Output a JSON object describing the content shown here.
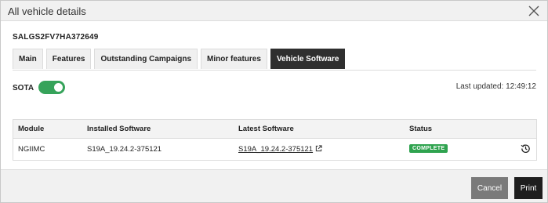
{
  "dialog": {
    "title": "All vehicle details",
    "close_icon": "close-icon"
  },
  "vin": "SALGS2FV7HA372649",
  "tabs": [
    {
      "label": "Main",
      "active": false
    },
    {
      "label": "Features",
      "active": false
    },
    {
      "label": "Outstanding Campaigns",
      "active": false
    },
    {
      "label": "Minor features",
      "active": false
    },
    {
      "label": "Vehicle Software",
      "active": true
    }
  ],
  "sota": {
    "label": "SOTA",
    "enabled": true,
    "toggle_color": "#36a35a"
  },
  "last_updated": "Last updated: 12:49:12",
  "table": {
    "headers": [
      "Module",
      "Installed Software",
      "Latest Software",
      "Status"
    ],
    "rows": [
      {
        "module": "NGIIMC",
        "installed": "S19A_19.24.2-375121",
        "latest": "S19A_19.24.2-375121",
        "status": "COMPLETE",
        "status_color": "#2fa34f",
        "action_icon": "history-icon"
      }
    ]
  },
  "footer": {
    "cancel_label": "Cancel",
    "print_label": "Print"
  }
}
